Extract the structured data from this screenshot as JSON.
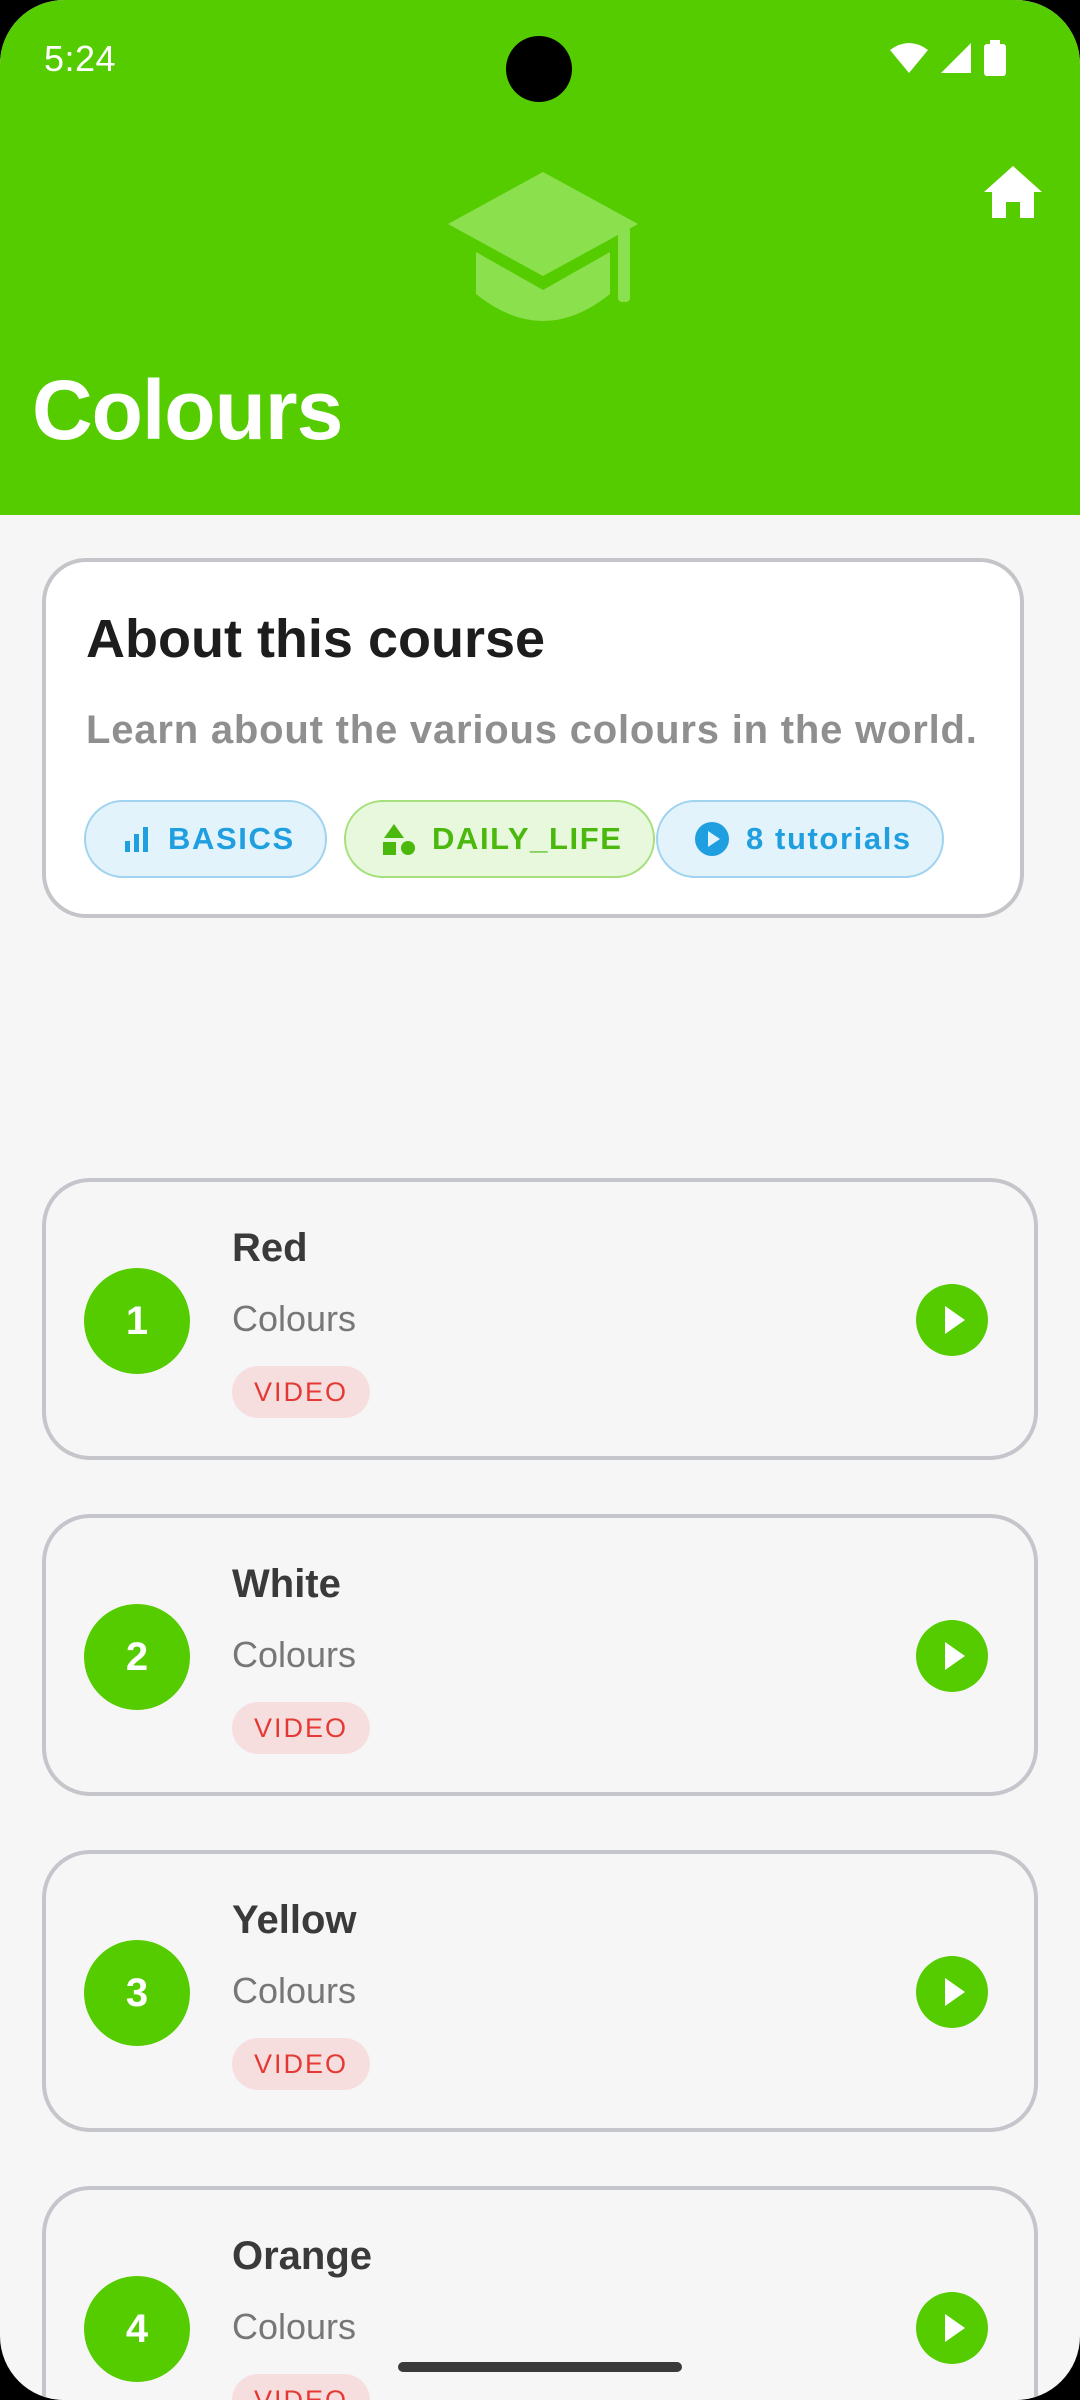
{
  "status_bar": {
    "time": "5:24"
  },
  "header": {
    "title": "Colours"
  },
  "about": {
    "heading": "About this course",
    "description": "Learn about the various colours in the world.",
    "chips": [
      {
        "label": "BASICS",
        "icon": "bar-chart-icon",
        "color": "#1f9ee0"
      },
      {
        "label": "DAILY_LIFE",
        "icon": "shapes-icon",
        "color": "#4ab80c"
      },
      {
        "label": "8 tutorials",
        "icon": "play-circle-icon",
        "color": "#1f9ee0"
      }
    ]
  },
  "lessons": [
    {
      "number": "1",
      "title": "Red",
      "subtitle": "Colours",
      "badge": "VIDEO"
    },
    {
      "number": "2",
      "title": "White",
      "subtitle": "Colours",
      "badge": "VIDEO"
    },
    {
      "number": "3",
      "title": "Yellow",
      "subtitle": "Colours",
      "badge": "VIDEO"
    },
    {
      "number": "4",
      "title": "Orange",
      "subtitle": "Colours",
      "badge": "VIDEO"
    }
  ],
  "colors": {
    "primary": "#55cc00",
    "badge_red": "#e53935",
    "chip_blue": "#1f9ee0",
    "background": "#f6f6f6"
  }
}
